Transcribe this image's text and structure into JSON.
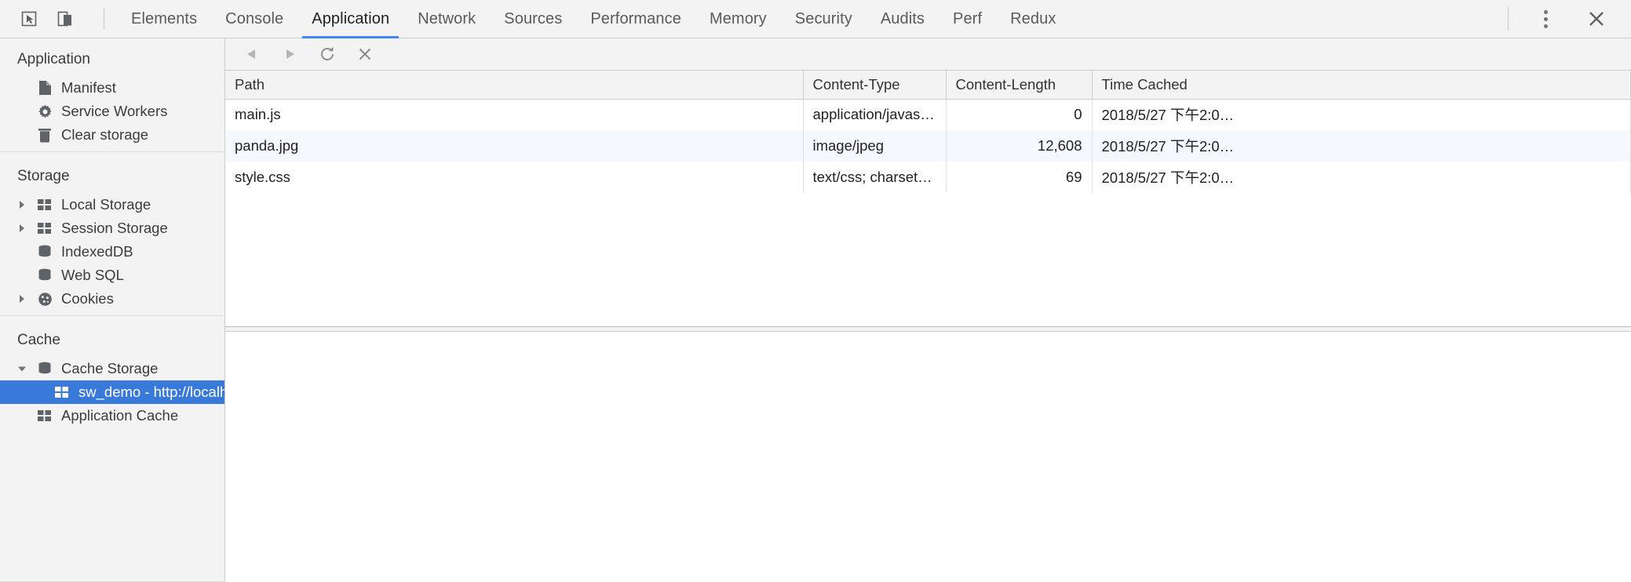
{
  "topbar": {
    "icons": [
      {
        "name": "inspect-element-icon",
        "glyph": "cursor-box"
      },
      {
        "name": "toggle-device-toolbar-icon",
        "glyph": "device"
      }
    ],
    "tabs": [
      {
        "label": "Elements",
        "active": false
      },
      {
        "label": "Console",
        "active": false
      },
      {
        "label": "Application",
        "active": true
      },
      {
        "label": "Network",
        "active": false
      },
      {
        "label": "Sources",
        "active": false
      },
      {
        "label": "Performance",
        "active": false
      },
      {
        "label": "Memory",
        "active": false
      },
      {
        "label": "Security",
        "active": false
      },
      {
        "label": "Audits",
        "active": false
      },
      {
        "label": "Perf",
        "active": false
      },
      {
        "label": "Redux",
        "active": false
      }
    ],
    "more_label": "more-options",
    "close_label": "close-devtools"
  },
  "sidebar": {
    "sections": [
      {
        "title": "Application",
        "items": [
          {
            "label": "Manifest",
            "icon": "manifest-file-icon",
            "twisty": "none",
            "indent": "noarrow",
            "selected": false
          },
          {
            "label": "Service Workers",
            "icon": "gear-icon",
            "twisty": "none",
            "indent": "noarrow",
            "selected": false
          },
          {
            "label": "Clear storage",
            "icon": "trash-icon",
            "twisty": "none",
            "indent": "noarrow",
            "selected": false
          }
        ]
      },
      {
        "title": "Storage",
        "items": [
          {
            "label": "Local Storage",
            "icon": "table-grid-icon",
            "twisty": "collapsed",
            "indent": "arrow",
            "selected": false
          },
          {
            "label": "Session Storage",
            "icon": "table-grid-icon",
            "twisty": "collapsed",
            "indent": "arrow",
            "selected": false
          },
          {
            "label": "IndexedDB",
            "icon": "database-icon",
            "twisty": "none",
            "indent": "noarrow",
            "selected": false
          },
          {
            "label": "Web SQL",
            "icon": "database-icon",
            "twisty": "none",
            "indent": "noarrow",
            "selected": false
          },
          {
            "label": "Cookies",
            "icon": "cookie-icon",
            "twisty": "collapsed",
            "indent": "arrow",
            "selected": false
          }
        ]
      },
      {
        "title": "Cache",
        "items": [
          {
            "label": "Cache Storage",
            "icon": "database-icon",
            "twisty": "expanded",
            "indent": "arrow",
            "selected": false
          },
          {
            "label": "sw_demo - http://localh",
            "icon": "table-grid-icon",
            "twisty": "none",
            "indent": "child",
            "selected": true
          },
          {
            "label": "Application Cache",
            "icon": "table-grid-icon",
            "twisty": "none",
            "indent": "noarrow",
            "selected": false
          }
        ]
      }
    ]
  },
  "panel": {
    "toolbar": [
      {
        "name": "back-button",
        "glyph": "triangle-left",
        "label": "Back"
      },
      {
        "name": "forward-button",
        "glyph": "triangle-right",
        "label": "Forward"
      },
      {
        "name": "refresh-button",
        "glyph": "reload",
        "label": "Refresh"
      },
      {
        "name": "delete-selected-button",
        "glyph": "cross",
        "label": "Delete Selected"
      }
    ],
    "table": {
      "columns": [
        "Path",
        "Content-Type",
        "Content-Length",
        "Time Cached"
      ],
      "rows": [
        {
          "path": "main.js",
          "content_type": "application/javasc…",
          "content_length": "0",
          "time_cached": "2018/5/27 下午2:0…"
        },
        {
          "path": "panda.jpg",
          "content_type": "image/jpeg",
          "content_length": "12,608",
          "time_cached": "2018/5/27 下午2:0…"
        },
        {
          "path": "style.css",
          "content_type": "text/css; charset=…",
          "content_length": "69",
          "time_cached": "2018/5/27 下午2:0…"
        }
      ]
    }
  },
  "colors": {
    "accent": "#4285f4",
    "selection": "#3879d9",
    "chrome_bg": "#f3f3f3",
    "row_alt": "#f5f8fd",
    "text": "#3c3c3c",
    "icon": "#5f6368"
  }
}
